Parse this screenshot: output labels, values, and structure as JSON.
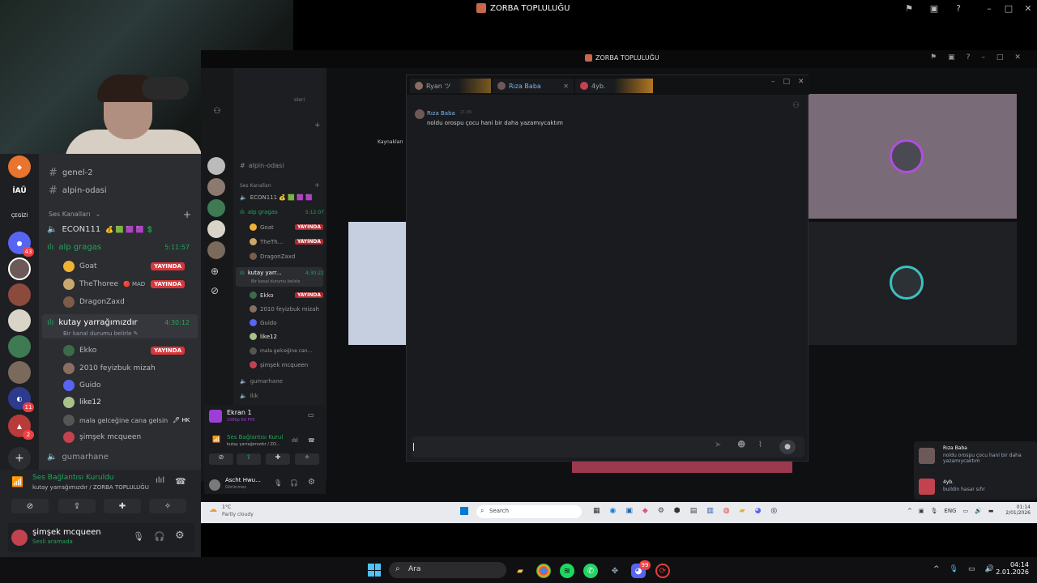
{
  "window": {
    "title": "ZORBA TOPLULUĞU"
  },
  "left": {
    "channels_text": [
      "genel-2",
      "alpin-odasi"
    ],
    "voice_section": "Ses Kanalları",
    "voice_channels": [
      {
        "name": "ECON111",
        "emoji": "💰 🟩 🟪 🟪 💲"
      },
      {
        "name": "alp gragas",
        "timer": "5:11:57"
      },
      {
        "name": "kutay yarrağımızdır",
        "timer": "4:30:12",
        "status": "Bir kanal durumu belirle"
      },
      {
        "name": "gumarhane"
      }
    ],
    "alp_users": [
      {
        "name": "Goat",
        "live": "YAYINDA"
      },
      {
        "name": "TheThoree",
        "tag": "🔴 MAD",
        "live": "YAYINDA"
      },
      {
        "name": "DragonZaxd"
      }
    ],
    "kutay_users": [
      {
        "name": "Ekko",
        "live": "YAYINDA"
      },
      {
        "name": "2010 feyizbuk mizah"
      },
      {
        "name": "Guido"
      },
      {
        "name": "like12"
      },
      {
        "name": "mala gelceğine cana gelsin",
        "tag": "🖊 HK"
      },
      {
        "name": "şimşek mcqueen"
      }
    ],
    "server_labels": [
      "İAÜ",
      "ÇEGİZİ"
    ],
    "server_badges": [
      "43",
      "11",
      "2"
    ],
    "voice_status": "Ses Bağlantısı Kuruldu",
    "voice_location": "kutay yarrağımızdır / ZORBA TOPLULUĞU",
    "user_name": "şimşek mcqueen",
    "user_status": "Sesli aramada"
  },
  "share": {
    "title": "ZORBA TOPLULUĞU",
    "kaynaklar": "Kaynakları",
    "chan_partial": "eleri",
    "channels_text": [
      "alpin-odasi"
    ],
    "voice_section": "Ses Kanalları",
    "voice_channels": [
      {
        "name": "ECON111 💰 🟩 🟪 🟪"
      },
      {
        "name": "alp gragas",
        "timer": "5:12:07"
      },
      {
        "name": "kutay yarr...",
        "timer": "4:30:22",
        "status": "Bir kanal durumu belirle"
      },
      {
        "name": "gumarhane"
      },
      {
        "name": "Ilık"
      }
    ],
    "alp_users": [
      {
        "name": "Goat",
        "live": "YAYINDA"
      },
      {
        "name": "TheTh...",
        "live": "YAYINDA"
      },
      {
        "name": "DragonZaxd"
      }
    ],
    "kutay_users": [
      {
        "name": "Ekko",
        "live": "YAYINDA"
      },
      {
        "name": "2010 feyizbuk mizah"
      },
      {
        "name": "Guido"
      },
      {
        "name": "like12"
      },
      {
        "name": "mala gelceğine can..."
      },
      {
        "name": "şimşek mcqueen"
      }
    ],
    "ekran": "Ekran 1",
    "ekran_sub": "1080p 60 FPS",
    "voice_status": "Ses Bağlantısı Kurul",
    "voice_location": "kutay yarrağımızdır / ZO...",
    "user_name": "Ascht Hwu...",
    "user_status": "Görünmez"
  },
  "popup": {
    "tabs": [
      "Ryan ツ",
      "Rıza Baba",
      "4yb."
    ],
    "message_author": "Rıza Baba",
    "message_time": "21:06",
    "message_text": "noldu orospu çocu hani bir daha yazamıycaktım"
  },
  "notification": {
    "items": [
      {
        "author": "Rıza Baba",
        "text": "noldu orospu çocu hani bir daha yazamıycaktım"
      },
      {
        "author": "4yb.",
        "text": "buildin hasar sıfır"
      }
    ]
  },
  "inner_taskbar": {
    "weather_temp": "1°C",
    "weather_text": "Partly cloudy",
    "search": "Search",
    "lang": "ENG",
    "time": "01:14",
    "date": "2/01/2026"
  },
  "taskbar": {
    "search": "Ara",
    "time": "04:14",
    "date": "2.01.2026",
    "discord_badge": "99"
  },
  "colors": {
    "live": "#da373c",
    "voice_green": "#23a55a",
    "bg": "#2b2d31"
  }
}
